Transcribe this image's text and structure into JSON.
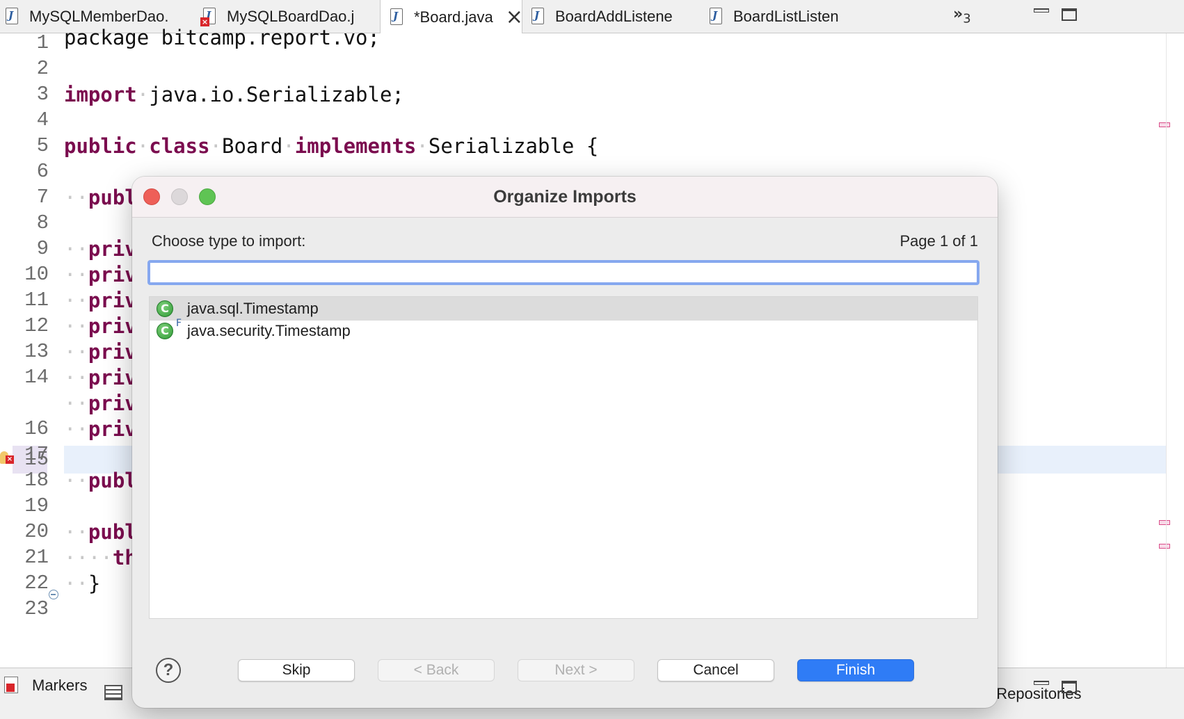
{
  "tabs": [
    {
      "label": "MySQLMemberDao.",
      "icon": "java-file-icon",
      "error": false,
      "active": false
    },
    {
      "label": "MySQLBoardDao.j",
      "icon": "java-file-error-icon",
      "error": true,
      "active": false
    },
    {
      "label": "*Board.java",
      "icon": "java-file-icon",
      "error": false,
      "active": true
    },
    {
      "label": "BoardAddListene",
      "icon": "java-file-icon",
      "error": false,
      "active": false
    },
    {
      "label": "BoardListListen",
      "icon": "java-file-icon",
      "error": false,
      "active": false
    }
  ],
  "tab_overflow": {
    "symbol": "»",
    "count": "3"
  },
  "editor": {
    "line_numbers": [
      "1",
      "2",
      "3",
      "4",
      "5",
      "6",
      "7",
      "8",
      "9",
      "10",
      "11",
      "12",
      "13",
      "14",
      "15",
      "16",
      "17",
      "18",
      "19",
      "20",
      "21",
      "22",
      "23"
    ],
    "current_line": "15",
    "code": {
      "l1": "package bitcamp.report.vo;",
      "l3_kw": "import",
      "l3_rest": "java.io.Serializable;",
      "l5_kw1": "public",
      "l5_kw2": "class",
      "l5_name": "Board",
      "l5_kw3": "implements",
      "l5_rest": "Serializable {",
      "l7": "publ",
      "priv": "priv",
      "l18": "publ",
      "l20": "publ",
      "l21": "th",
      "l22": "}"
    }
  },
  "dialog": {
    "title": "Organize Imports",
    "prompt": "Choose type to import:",
    "page_info": "Page 1 of 1",
    "search_value": "",
    "items": [
      {
        "label": "java.sql.Timestamp",
        "selected": true,
        "final": false
      },
      {
        "label": "java.security.Timestamp",
        "selected": false,
        "final": true
      }
    ],
    "final_marker": "F",
    "class_icon_glyph": "C",
    "buttons": {
      "skip": "Skip",
      "back": "< Back",
      "next": "Next >",
      "cancel": "Cancel",
      "finish": "Finish"
    },
    "help": "?"
  },
  "bottom": {
    "markers_label": "Markers",
    "repositories_label": "t Repositories"
  },
  "colors": {
    "keyword": "#7b0d4f",
    "accent": "#2f7cf6",
    "selection": "#dcdcdc",
    "current_line": "#e8f0fb"
  }
}
